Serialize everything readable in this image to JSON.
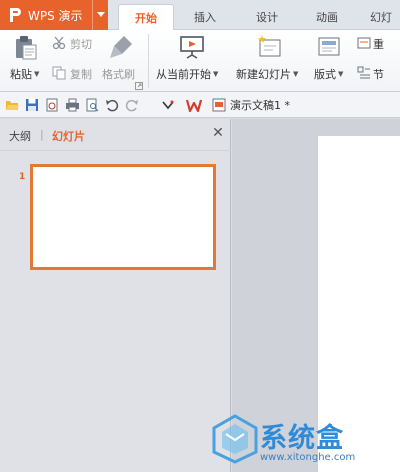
{
  "app": {
    "name": "WPS 演示"
  },
  "tabs": [
    {
      "label": "开始",
      "active": true
    },
    {
      "label": "插入",
      "active": false
    },
    {
      "label": "设计",
      "active": false
    },
    {
      "label": "动画",
      "active": false
    },
    {
      "label": "幻灯",
      "active": false
    }
  ],
  "ribbon": {
    "paste": "粘贴",
    "cut": "剪切",
    "copy": "复制",
    "format_painter": "格式刷",
    "from_current": "从当前开始",
    "new_slide": "新建幻灯片",
    "layout": "版式",
    "reset": "重",
    "section": "节"
  },
  "quickbar": {
    "document_tab": "演示文稿1 *"
  },
  "pane": {
    "outline_tab": "大纲",
    "slides_tab": "幻灯片",
    "slide_number": "1"
  },
  "watermark": {
    "text": "系统盒",
    "url": "www.xitonghe.com"
  },
  "colors": {
    "accent": "#e8632c",
    "thumb_border": "#e07b36",
    "watermark": "#2f8ad8"
  }
}
